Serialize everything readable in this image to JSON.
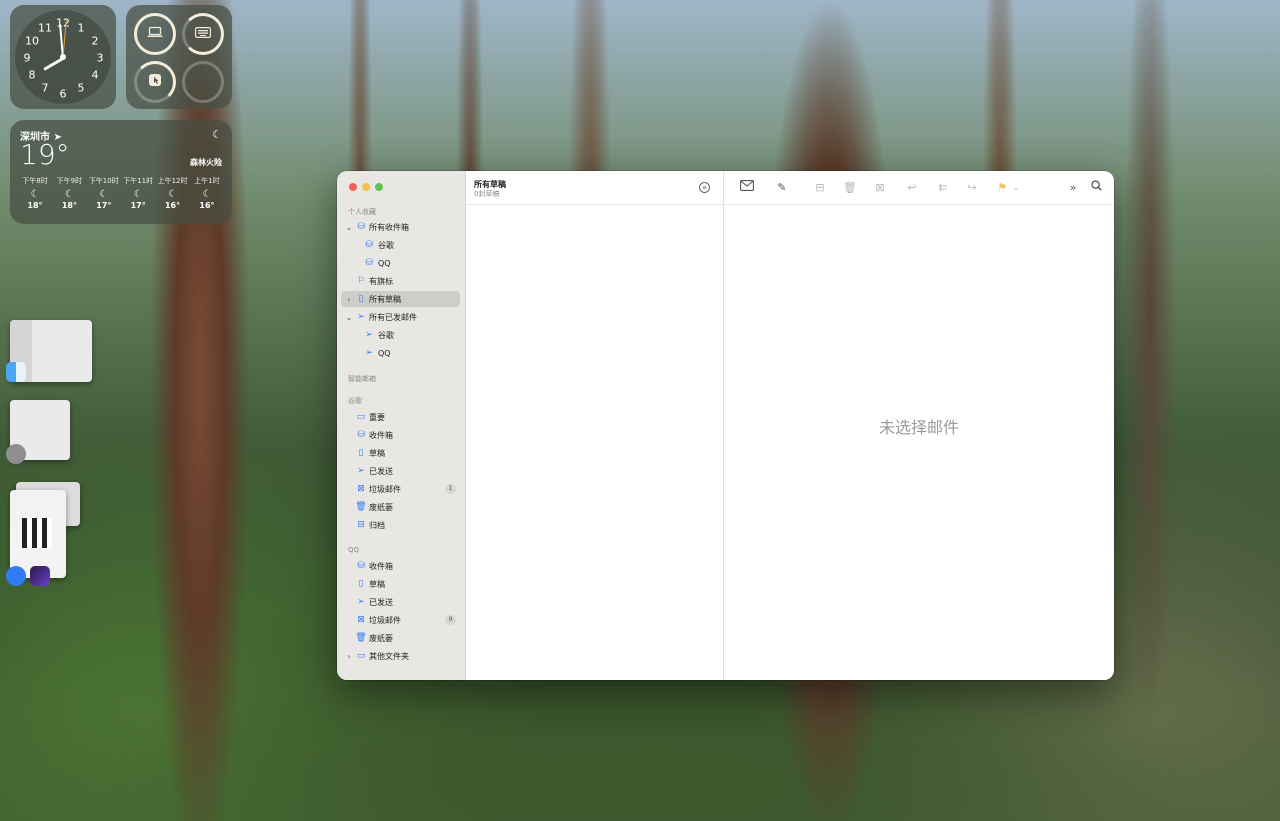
{
  "clock": {
    "numbers": [
      "12",
      "1",
      "2",
      "3",
      "4",
      "5",
      "6",
      "7",
      "8",
      "9",
      "10",
      "11"
    ]
  },
  "battery_widget": {
    "devices": [
      "laptop-icon",
      "keyboard-icon",
      "mouse-icon",
      "empty"
    ]
  },
  "weather": {
    "city": "深圳市",
    "temp": "19°",
    "condition": "森林火险",
    "hours": [
      {
        "time": "下午8时",
        "temp": "18°"
      },
      {
        "time": "下午9时",
        "temp": "18°"
      },
      {
        "time": "下午10时",
        "temp": "17°"
      },
      {
        "time": "下午11时",
        "temp": "17°"
      },
      {
        "time": "上午12时",
        "temp": "16°"
      },
      {
        "time": "上午1时",
        "temp": "16°"
      }
    ]
  },
  "sidebar": {
    "sections": {
      "favorites": "个人收藏",
      "smart": "智能邮箱",
      "google": "谷歌",
      "qq": "QQ"
    },
    "favorites": [
      {
        "label": "所有收件箱",
        "icon": "inbox-icon",
        "chevron": "⌄"
      },
      {
        "label": "谷歌",
        "icon": "inbox-icon"
      },
      {
        "label": "QQ",
        "icon": "inbox-icon"
      },
      {
        "label": "有旗标",
        "icon": "flag-icon"
      },
      {
        "label": "所有草稿",
        "icon": "draft-icon",
        "chevron": "›"
      },
      {
        "label": "所有已发邮件",
        "icon": "sent-icon",
        "chevron": "⌄"
      },
      {
        "label": "谷歌",
        "icon": "sent-icon"
      },
      {
        "label": "QQ",
        "icon": "sent-icon"
      }
    ],
    "google": [
      {
        "label": "重要",
        "icon": "folder-icon"
      },
      {
        "label": "收件箱",
        "icon": "inbox-icon"
      },
      {
        "label": "草稿",
        "icon": "draft-icon"
      },
      {
        "label": "已发送",
        "icon": "sent-icon"
      },
      {
        "label": "垃圾邮件",
        "icon": "junk-icon",
        "badge": "1"
      },
      {
        "label": "废纸篓",
        "icon": "trash-icon"
      },
      {
        "label": "归档",
        "icon": "archive-icon"
      }
    ],
    "qq": [
      {
        "label": "收件箱",
        "icon": "inbox-icon"
      },
      {
        "label": "草稿",
        "icon": "draft-icon"
      },
      {
        "label": "已发送",
        "icon": "sent-icon"
      },
      {
        "label": "垃圾邮件",
        "icon": "junk-icon",
        "badge": "9"
      },
      {
        "label": "废纸篓",
        "icon": "trash-icon"
      },
      {
        "label": "其他文件夹",
        "icon": "folder-icon",
        "chevron": "›"
      }
    ]
  },
  "list": {
    "title": "所有草稿",
    "subtitle": "0封草稿"
  },
  "message": {
    "empty": "未选择邮件"
  }
}
